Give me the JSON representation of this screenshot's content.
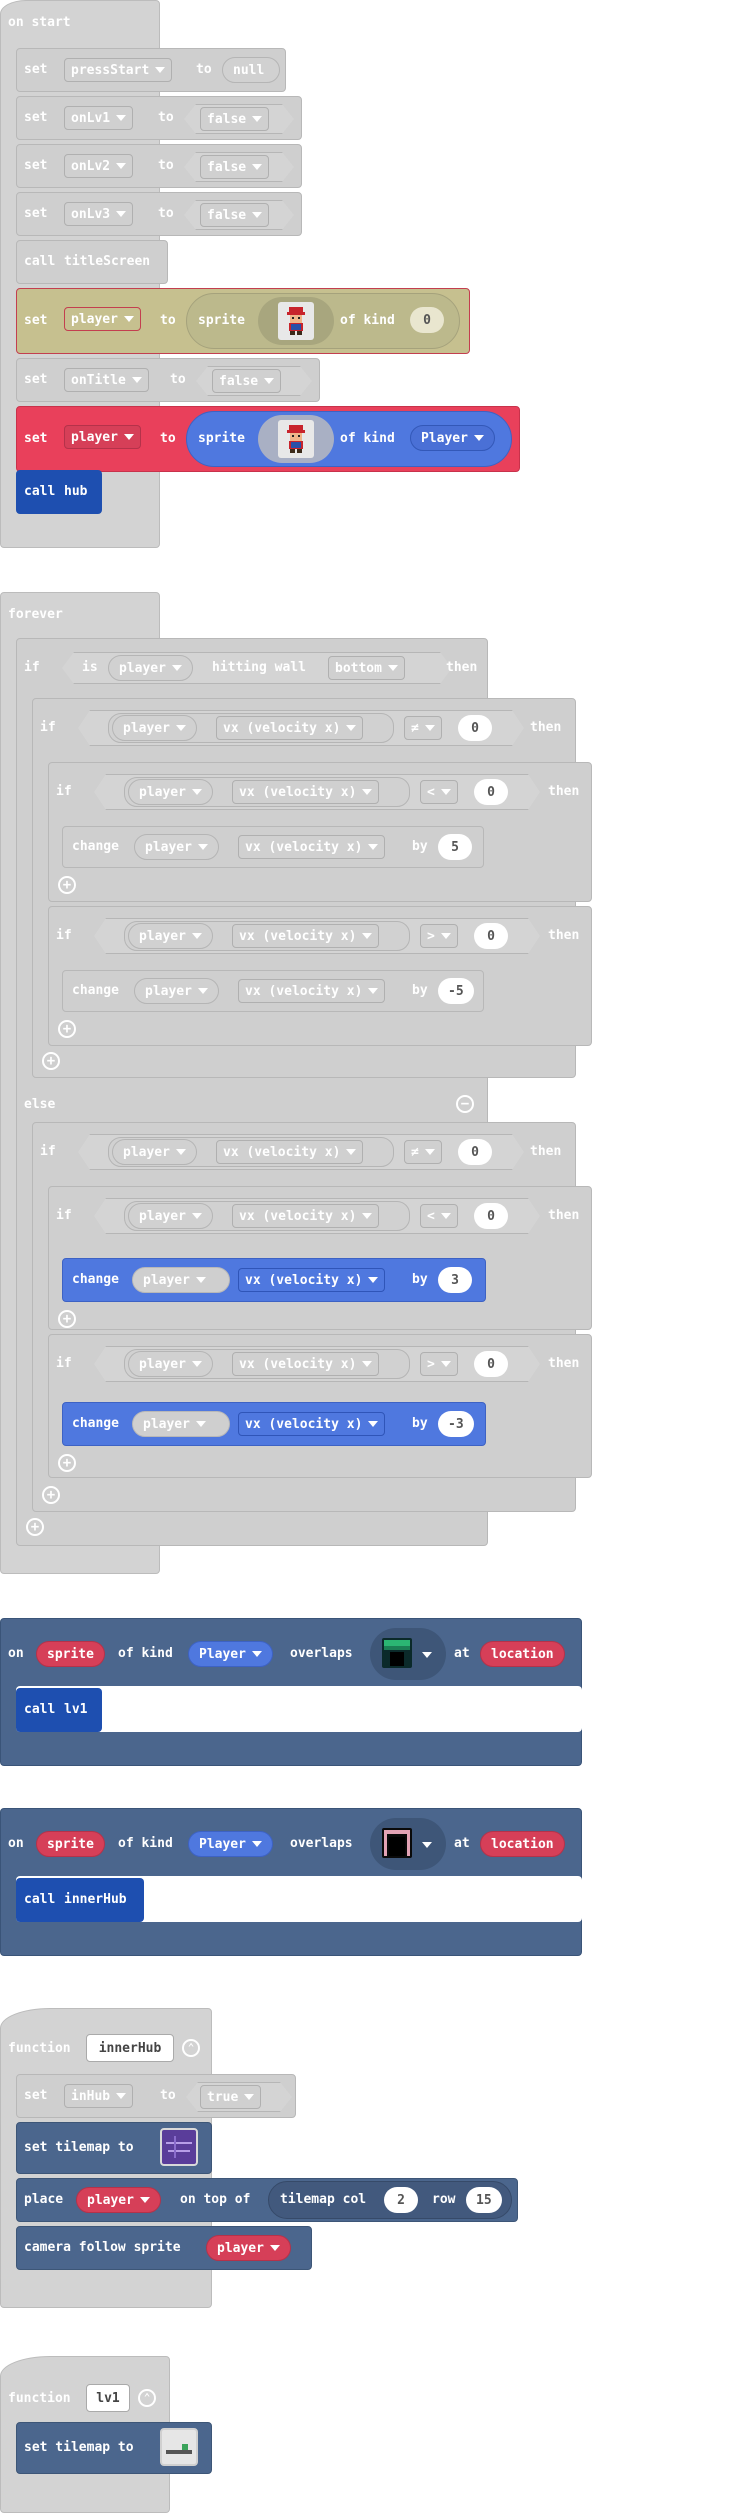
{
  "kw": {
    "set": "set",
    "to": "to",
    "call": "call",
    "change": "change",
    "by": "by",
    "if": "if",
    "then": "then",
    "else": "else",
    "is": "is",
    "hitting_wall": "hitting wall",
    "of_kind": "of kind",
    "sprite": "sprite",
    "on": "on",
    "overlaps": "overlaps",
    "at": "at",
    "function": "function",
    "place": "place",
    "on_top_of": "on top of",
    "tilemap_col": "tilemap col",
    "row": "row",
    "set_tilemap_to": "set tilemap to",
    "camera_follow": "camera follow sprite",
    "forever": "forever",
    "on_start": "on start"
  },
  "on_start": {
    "sets": [
      {
        "var": "pressStart",
        "value": "null"
      },
      {
        "var": "onLv1",
        "value": "false"
      },
      {
        "var": "onLv2",
        "value": "false"
      },
      {
        "var": "onLv3",
        "value": "false"
      }
    ],
    "call1": "titleScreen",
    "player_var": "player",
    "kind_value": "0",
    "onTitle_var": "onTitle",
    "onTitle_value": "false",
    "kind_name": "Player",
    "call2": "hub"
  },
  "forever": {
    "sprite": "player",
    "wall": "bottom",
    "prop": "vx (velocity x)",
    "ops": {
      "ne": "≠",
      "lt": "<",
      "gt": ">"
    },
    "zero": "0",
    "by_values": [
      "5",
      "-5",
      "3",
      "-3"
    ]
  },
  "overlap1": {
    "sprite": "sprite",
    "kind": "Player",
    "location": "location",
    "call": "lv1"
  },
  "overlap2": {
    "sprite": "sprite",
    "kind": "Player",
    "location": "location",
    "call": "innerHub"
  },
  "fn_innerHub": {
    "name": "innerHub",
    "var": "inHub",
    "value": "true",
    "sprite": "player",
    "col": "2",
    "row": "15",
    "follow": "player"
  },
  "fn_lv1": {
    "name": "lv1"
  },
  "colors": {
    "gray": "#cfcfcf",
    "red": "#d63f58",
    "blue": "#4f78df",
    "dark_blue": "#1e4fb0",
    "slate": "#4b668d",
    "crimson": "#e9405b"
  }
}
